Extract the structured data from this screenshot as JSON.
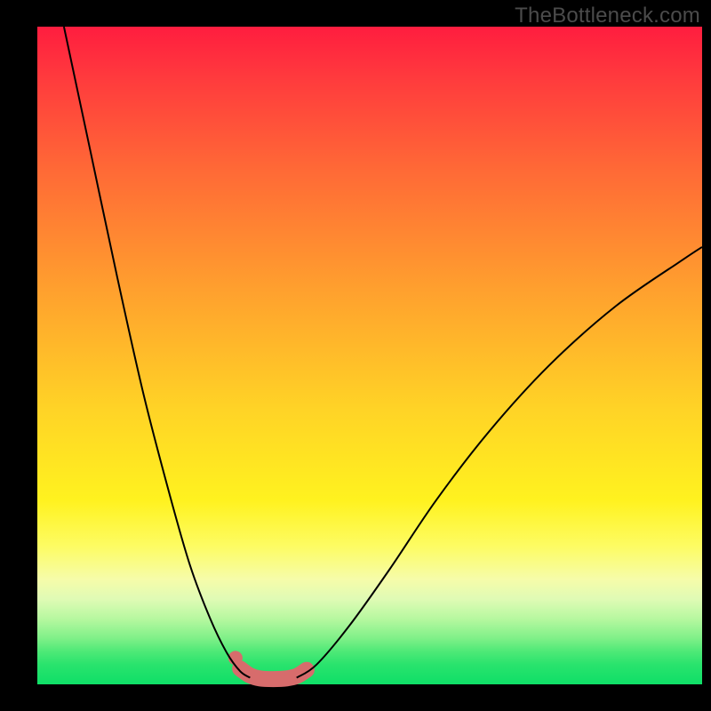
{
  "watermark": "TheBottleneck.com",
  "chart_data": {
    "type": "line",
    "title": "",
    "xlabel": "",
    "ylabel": "",
    "xlim": [
      0,
      1
    ],
    "ylim": [
      0,
      1
    ],
    "grid": false,
    "legend": false,
    "series": [
      {
        "name": "left-branch",
        "x": [
          0.04,
          0.08,
          0.12,
          0.16,
          0.2,
          0.23,
          0.26,
          0.285,
          0.305,
          0.32
        ],
        "y": [
          1.0,
          0.81,
          0.62,
          0.44,
          0.285,
          0.18,
          0.1,
          0.048,
          0.02,
          0.01
        ]
      },
      {
        "name": "right-branch",
        "x": [
          0.39,
          0.42,
          0.47,
          0.53,
          0.6,
          0.68,
          0.77,
          0.87,
          0.97,
          1.0
        ],
        "y": [
          0.01,
          0.03,
          0.09,
          0.175,
          0.28,
          0.385,
          0.485,
          0.575,
          0.645,
          0.665
        ]
      },
      {
        "name": "valley-highlight",
        "x": [
          0.305,
          0.319,
          0.335,
          0.355,
          0.375,
          0.391,
          0.405
        ],
        "y": [
          0.024,
          0.014,
          0.009,
          0.008,
          0.009,
          0.013,
          0.022
        ]
      }
    ],
    "annotations": [
      {
        "name": "valley-entry-dot",
        "x": 0.298,
        "y": 0.04
      }
    ],
    "background_gradient": {
      "direction": "vertical",
      "stops": [
        {
          "pos": 0.0,
          "color": "#ff1d3f"
        },
        {
          "pos": 0.4,
          "color": "#ffa02e"
        },
        {
          "pos": 0.72,
          "color": "#fff21f"
        },
        {
          "pos": 0.9,
          "color": "#b7f8a0"
        },
        {
          "pos": 1.0,
          "color": "#0fdf67"
        }
      ]
    }
  }
}
